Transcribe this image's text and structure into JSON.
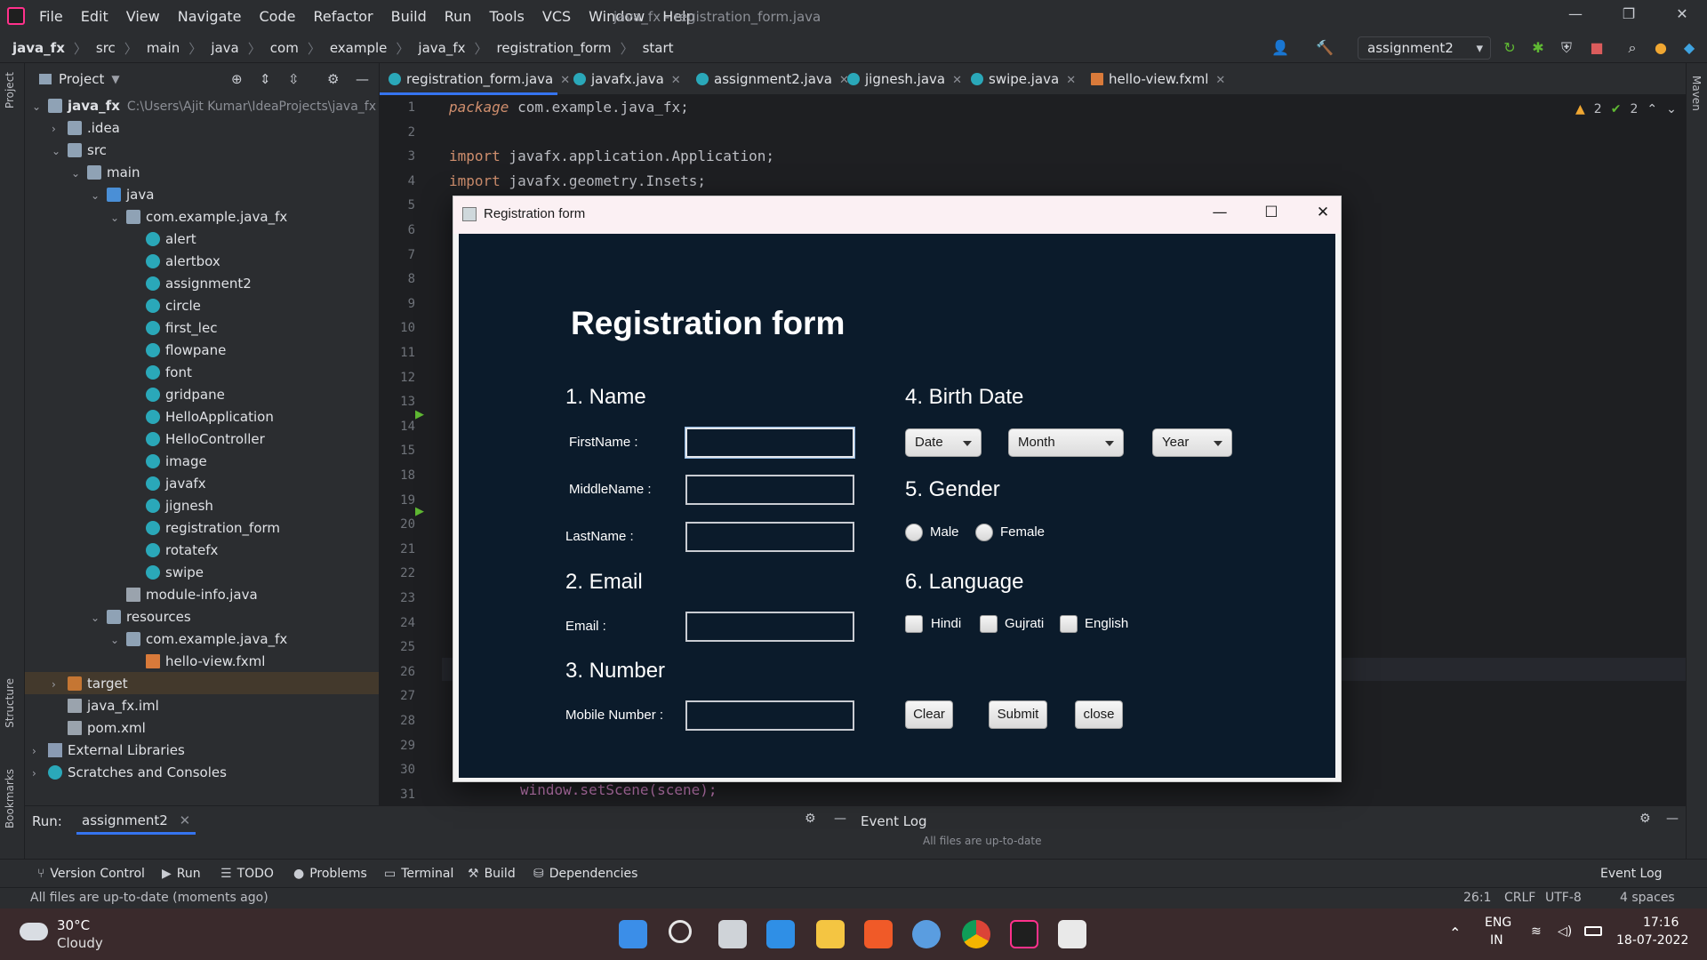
{
  "ide": {
    "menu": [
      "File",
      "Edit",
      "View",
      "Navigate",
      "Code",
      "Refactor",
      "Build",
      "Run",
      "Tools",
      "VCS",
      "Window",
      "Help"
    ],
    "window_title": "java_fx - registration_form.java",
    "breadcrumbs": [
      "java_fx",
      "src",
      "main",
      "java",
      "com",
      "example",
      "java_fx",
      "registration_form",
      "start"
    ],
    "run_config": "assignment2",
    "project_label": "Project",
    "tree": [
      {
        "label": "java_fx",
        "path": "C:\\Users\\Ajit Kumar\\IdeaProjects\\java_fx",
        "depth": 0,
        "icon": "folder",
        "arrow": "v"
      },
      {
        "label": ".idea",
        "depth": 1,
        "icon": "folder",
        "arrow": ">"
      },
      {
        "label": "src",
        "depth": 1,
        "icon": "folder",
        "arrow": "v"
      },
      {
        "label": "main",
        "depth": 2,
        "icon": "folder",
        "arrow": "v"
      },
      {
        "label": "java",
        "depth": 3,
        "icon": "folder-blue",
        "arrow": "v"
      },
      {
        "label": "com.example.java_fx",
        "depth": 4,
        "icon": "folder",
        "arrow": "v"
      },
      {
        "label": "alert",
        "depth": 5,
        "icon": "class"
      },
      {
        "label": "alertbox",
        "depth": 5,
        "icon": "class"
      },
      {
        "label": "assignment2",
        "depth": 5,
        "icon": "class"
      },
      {
        "label": "circle",
        "depth": 5,
        "icon": "class"
      },
      {
        "label": "first_lec",
        "depth": 5,
        "icon": "class"
      },
      {
        "label": "flowpane",
        "depth": 5,
        "icon": "class"
      },
      {
        "label": "font",
        "depth": 5,
        "icon": "class"
      },
      {
        "label": "gridpane",
        "depth": 5,
        "icon": "class"
      },
      {
        "label": "HelloApplication",
        "depth": 5,
        "icon": "class"
      },
      {
        "label": "HelloController",
        "depth": 5,
        "icon": "class"
      },
      {
        "label": "image",
        "depth": 5,
        "icon": "class"
      },
      {
        "label": "javafx",
        "depth": 5,
        "icon": "class"
      },
      {
        "label": "jignesh",
        "depth": 5,
        "icon": "class"
      },
      {
        "label": "registration_form",
        "depth": 5,
        "icon": "class"
      },
      {
        "label": "rotatefx",
        "depth": 5,
        "icon": "class"
      },
      {
        "label": "swipe",
        "depth": 5,
        "icon": "class"
      },
      {
        "label": "module-info.java",
        "depth": 4,
        "icon": "file"
      },
      {
        "label": "resources",
        "depth": 3,
        "icon": "folder",
        "arrow": "v"
      },
      {
        "label": "com.example.java_fx",
        "depth": 4,
        "icon": "folder",
        "arrow": "v"
      },
      {
        "label": "hello-view.fxml",
        "depth": 5,
        "icon": "fxml"
      },
      {
        "label": "target",
        "depth": 1,
        "icon": "folder-orange",
        "arrow": ">"
      },
      {
        "label": "java_fx.iml",
        "depth": 1,
        "icon": "file"
      },
      {
        "label": "pom.xml",
        "depth": 1,
        "icon": "file"
      },
      {
        "label": "External Libraries",
        "depth": 0,
        "icon": "lib",
        "arrow": ">"
      },
      {
        "label": "Scratches and Consoles",
        "depth": 0,
        "icon": "class",
        "arrow": ">"
      }
    ],
    "tabs": [
      "registration_form.java",
      "javafx.java",
      "assignment2.java",
      "jignesh.java",
      "swipe.java",
      "hello-view.fxml"
    ],
    "line_numbers": [
      "1",
      "2",
      "3",
      "4",
      "5",
      "6",
      "7",
      "8",
      "9",
      "10",
      "11",
      "12",
      "13",
      "14",
      "15",
      "18",
      "19",
      "20",
      "21",
      "22",
      "23",
      "24",
      "25",
      "26",
      "27",
      "28",
      "29",
      "30",
      "31"
    ],
    "code": {
      "line1_kw": "package",
      "line1_rest": " com.example.java_fx;",
      "line3_kw": "import",
      "line3_rest": " javafx.application.Application;",
      "line4_kw": "import",
      "line4_rest": " javafx.geometry.Insets;",
      "line31": "window.setScene(scene);"
    },
    "badges": {
      "warnings": "2",
      "ok": "2"
    },
    "run_label": "Run:",
    "run_tab": "assignment2",
    "event_log_title": "Event Log",
    "event_log_text": "All files are up-to-date",
    "tool_windows": [
      "Version Control",
      "Run",
      "TODO",
      "Problems",
      "Terminal",
      "Build",
      "Dependencies"
    ],
    "event_log_button": "Event Log",
    "status_message": "All files are up-to-date (moments ago)",
    "status_right": [
      "26:1",
      "CRLF",
      "UTF-8",
      "4 spaces"
    ],
    "left_stripe": [
      "Project",
      "Structure",
      "Bookmarks"
    ],
    "right_stripe": [
      "Maven"
    ]
  },
  "taskbar": {
    "weather_temp": "30°C",
    "weather_desc": "Cloudy",
    "lang_top": "ENG",
    "lang_bottom": "IN",
    "time": "17:16",
    "date": "18-07-2022"
  },
  "dialog": {
    "window_title": "Registration form",
    "heading": "Registration form",
    "sections": {
      "name": "1. Name",
      "email": "2. Email",
      "number": "3. Number",
      "birth": "4. Birth Date",
      "gender": "5. Gender",
      "language": "6. Language"
    },
    "labels": {
      "first": "FirstName :",
      "middle": "MiddleName :",
      "last": "LastName :",
      "email": "Email :",
      "mobile": "Mobile Number :"
    },
    "values": {
      "first": "",
      "middle": "",
      "last": "",
      "email": "",
      "mobile": ""
    },
    "combos": {
      "date": "Date",
      "month": "Month",
      "year": "Year"
    },
    "gender": [
      "Male",
      "Female"
    ],
    "languages": [
      "Hindi",
      "Gujrati",
      "English"
    ],
    "buttons": {
      "clear": "Clear",
      "submit": "Submit",
      "close": "close"
    }
  },
  "colors": {
    "scene_bg": "#0b1b2b",
    "accent": "#3574f0",
    "ide_bg": "#1e1f22"
  }
}
